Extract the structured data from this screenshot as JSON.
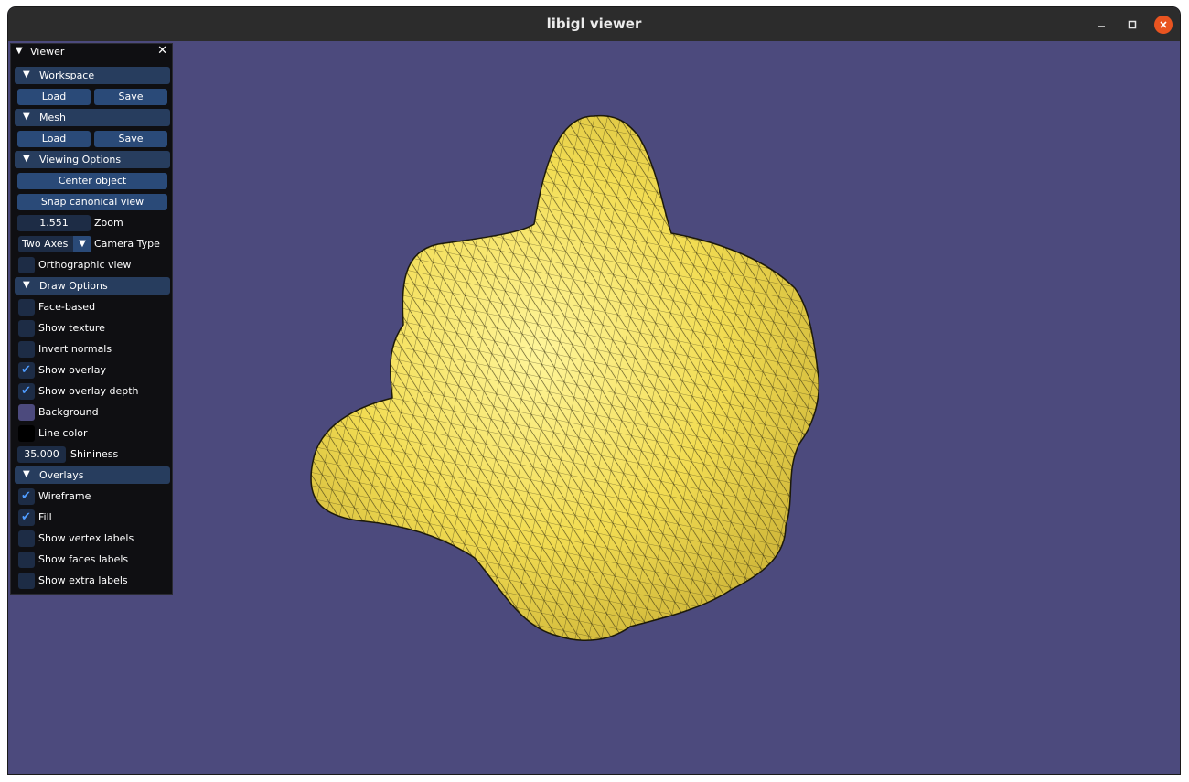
{
  "window": {
    "title": "libigl viewer",
    "minimize_icon": "minimize-icon",
    "maximize_icon": "maximize-icon",
    "close_icon": "close-icon"
  },
  "background_color": "#4c4a7d",
  "mesh_color": "#f2dc52",
  "panel": {
    "title": "Viewer",
    "workspace": {
      "label": "Workspace",
      "load": "Load",
      "save": "Save"
    },
    "mesh": {
      "label": "Mesh",
      "load": "Load",
      "save": "Save"
    },
    "viewing": {
      "label": "Viewing Options",
      "center": "Center object",
      "snap": "Snap canonical view",
      "zoom_value": "1.551",
      "zoom_label": "Zoom",
      "camera_value": "Two Axes",
      "camera_label": "Camera Type",
      "ortho_label": "Orthographic view",
      "ortho_checked": false
    },
    "draw": {
      "label": "Draw Options",
      "face_based": "Face-based",
      "show_texture": "Show texture",
      "invert_normals": "Invert normals",
      "show_overlay": "Show overlay",
      "show_overlay_depth": "Show overlay depth",
      "background": "Background",
      "line_color": "Line color",
      "shininess_value": "35.000",
      "shininess_label": "Shininess",
      "background_swatch": "#4c4a7d",
      "line_swatch": "#000000"
    },
    "overlays": {
      "label": "Overlays",
      "wireframe": "Wireframe",
      "fill": "Fill",
      "vertex_labels": "Show vertex labels",
      "faces_labels": "Show faces labels",
      "extra_labels": "Show extra labels"
    }
  }
}
